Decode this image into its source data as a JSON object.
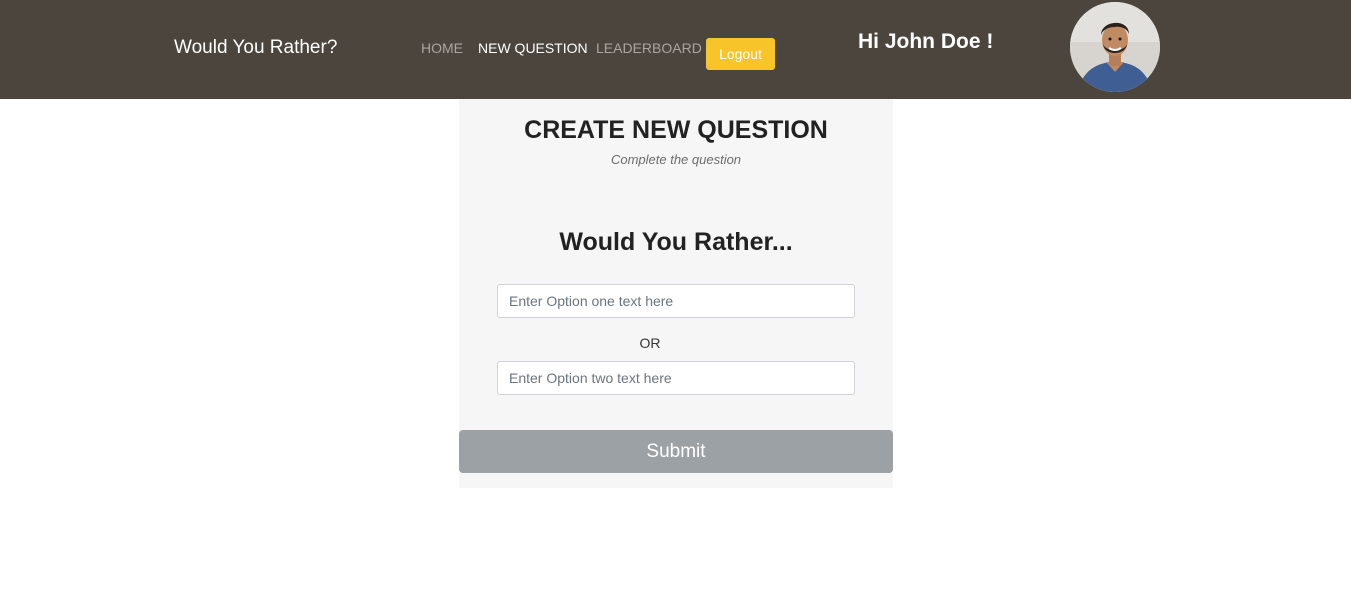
{
  "nav": {
    "brand": "Would You Rather?",
    "links": [
      {
        "label": "HOME",
        "active": false
      },
      {
        "label": "NEW QUESTION",
        "active": true
      },
      {
        "label": "LEADERBOARD",
        "active": false
      }
    ],
    "logout_label": "Logout",
    "greeting": "Hi John Doe !",
    "avatar_icon": "user-avatar-photo",
    "colors": {
      "bar": "#4b453e",
      "logout": "#f7c42a"
    }
  },
  "card": {
    "title": "CREATE NEW QUESTION",
    "subtitle": "Complete the question",
    "question": "Would You Rather...",
    "option_one": {
      "value": "",
      "placeholder": "Enter Option one text here"
    },
    "or_label": "OR",
    "option_two": {
      "value": "",
      "placeholder": "Enter Option two text here"
    },
    "submit_label": "Submit",
    "colors": {
      "background": "#f5f6f5",
      "submit": "#9ca1a6"
    }
  }
}
